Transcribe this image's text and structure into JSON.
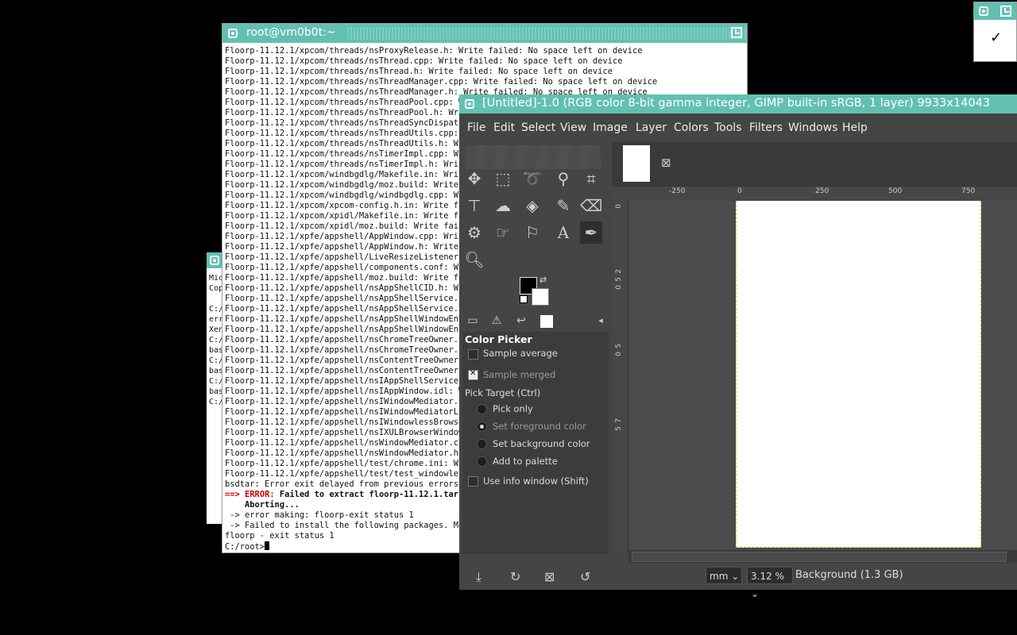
{
  "cmd_window": {
    "lines": [
      "Mic",
      "Cop",
      "",
      "C:/",
      "err",
      "Xen",
      "C:/",
      "bas",
      "C:/",
      "bas",
      "C:/",
      "bas",
      "C:/"
    ]
  },
  "terminal": {
    "title": "root@vm0b0t:~",
    "lines": [
      "Floorp-11.12.1/xpcom/threads/nsProxyRelease.h: Write failed: No space left on device",
      "Floorp-11.12.1/xpcom/threads/nsThread.cpp: Write failed: No space left on device",
      "Floorp-11.12.1/xpcom/threads/nsThread.h: Write failed: No space left on device",
      "Floorp-11.12.1/xpcom/threads/nsThreadManager.cpp: Write failed: No space left on device",
      "Floorp-11.12.1/xpcom/threads/nsThreadManager.h: Write failed: No space left on device",
      "Floorp-11.12.1/xpcom/threads/nsThreadPool.cpp: Wri",
      "Floorp-11.12.1/xpcom/threads/nsThreadPool.h: Writ",
      "Floorp-11.12.1/xpcom/threads/nsThreadSyncDispatch",
      "Floorp-11.12.1/xpcom/threads/nsThreadUtils.cpp: W",
      "Floorp-11.12.1/xpcom/threads/nsThreadUtils.h: Wri",
      "Floorp-11.12.1/xpcom/threads/nsTimerImpl.cpp: Wri",
      "Floorp-11.12.1/xpcom/threads/nsTimerImpl.h: Write",
      "Floorp-11.12.1/xpcom/windbgdlg/Makefile.in: Write",
      "Floorp-11.12.1/xpcom/windbgdlg/moz.build: Write fa",
      "Floorp-11.12.1/xpcom/windbgdlg/windbgdlg.cpp: Wri",
      "Floorp-11.12.1/xpcom/xpcom-config.h.in: Write fai",
      "Floorp-11.12.1/xpcom/xpidl/Makefile.in: Write fai",
      "Floorp-11.12.1/xpcom/xpidl/moz.build: Write faile",
      "Floorp-11.12.1/xpfe/appshell/AppWindow.cpp: Write",
      "Floorp-11.12.1/xpfe/appshell/AppWindow.h: Write f",
      "Floorp-11.12.1/xpfe/appshell/LiveResizeListener.h",
      "Floorp-11.12.1/xpfe/appshell/components.conf: Wri",
      "Floorp-11.12.1/xpfe/appshell/moz.build: Write fai",
      "Floorp-11.12.1/xpfe/appshell/nsAppShellCID.h: Wri",
      "Floorp-11.12.1/xpfe/appshell/nsAppShellService.cp",
      "Floorp-11.12.1/xpfe/appshell/nsAppShellService.h:",
      "Floorp-11.12.1/xpfe/appshell/nsAppShellWindowEnum",
      "Floorp-11.12.1/xpfe/appshell/nsAppShellWindowEnum",
      "Floorp-11.12.1/xpfe/appshell/nsChromeTreeOwner.cp",
      "Floorp-11.12.1/xpfe/appshell/nsChromeTreeOwner.h:",
      "Floorp-11.12.1/xpfe/appshell/nsContentTreeOwner.c",
      "Floorp-11.12.1/xpfe/appshell/nsContentTreeOwner.h",
      "Floorp-11.12.1/xpfe/appshell/nsIAppShellService.i",
      "Floorp-11.12.1/xpfe/appshell/nsIAppWindow.idl: Wr",
      "Floorp-11.12.1/xpfe/appshell/nsIWindowMediator.id",
      "Floorp-11.12.1/xpfe/appshell/nsIWindowMediatorLis",
      "Floorp-11.12.1/xpfe/appshell/nsIWindowlessBrowser",
      "Floorp-11.12.1/xpfe/appshell/nsIXULBrowserWindow.",
      "Floorp-11.12.1/xpfe/appshell/nsWindowMediator.cpp",
      "Floorp-11.12.1/xpfe/appshell/nsWindowMediator.h:",
      "Floorp-11.12.1/xpfe/appshell/test/chrome.ini: Wri",
      "Floorp-11.12.1/xpfe/appshell/test/test_windowless",
      "bsdtar: Error exit delayed from previous errors."
    ],
    "error_arrow": "==>",
    "error_label": "ERROR:",
    "error_msg": " Failed to extract floorp-11.12.1.tar.g",
    "aborting": "    Aborting...",
    "lines_after": [
      " -> error making: floorp-exit status 1",
      " -> Failed to install the following packages. Man",
      "floorp - exit status 1"
    ],
    "prompt": "C:/root>"
  },
  "check_window": {
    "mark": "✓"
  },
  "gimp": {
    "title": "[Untitled]-1.0 (RGB color 8-bit gamma integer, GIMP built-in sRGB, 1 layer) 9933x14043",
    "menu": [
      "File",
      "Edit",
      "Select",
      "View",
      "Image",
      "Layer",
      "Colors",
      "Tools",
      "Filters",
      "Windows",
      "Help"
    ],
    "tools": [
      "move-tool",
      "rect-select-tool",
      "lasso-tool",
      "fuzzy-select-tool",
      "crop-tool",
      "transform-tool",
      "warp-tool",
      "bucket-fill-tool",
      "paintbrush-tool",
      "eraser-tool",
      "clone-tool",
      "smudge-tool",
      "measure-tool",
      "text-tool",
      "color-picker-tool",
      "zoom-tool"
    ],
    "panel": {
      "title": "Color Picker",
      "sample_average": "Sample average",
      "sample_merged": "Sample merged",
      "pick_target": "Pick Target  (Ctrl)",
      "pick_only": "Pick only",
      "set_fg": "Set foreground color",
      "set_bg": "Set background color",
      "add_palette": "Add to palette",
      "use_info": "Use info window  (Shift)"
    },
    "ruler_h": [
      "-250",
      "0",
      "250",
      "500",
      "750"
    ],
    "ruler_v": [
      "0",
      "2",
      "5",
      "0",
      "5",
      "0",
      "7",
      "5"
    ],
    "status": {
      "unit": "mm",
      "zoom": "3.12 %",
      "text": "Background (1.3 GB)"
    },
    "colors": {
      "accent": "#62c0b3",
      "fg": "#000000",
      "bg": "#ffffff"
    }
  }
}
